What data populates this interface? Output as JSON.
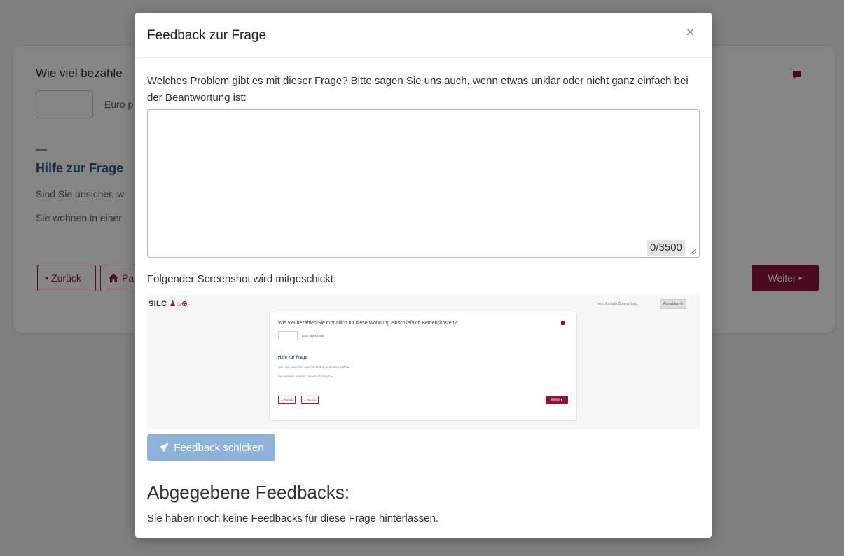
{
  "background": {
    "question_partial": "Wie viel bezahle",
    "unit_partial": "Euro p",
    "dash": "—",
    "help_title_partial": "Hilfe zur Frage",
    "help_link_1_partial": "Sind Sie unsicher, w",
    "help_link_2_partial": "Sie wohnen in einer",
    "back_label": "Zurück",
    "pause_label_partial": "Pa",
    "next_label": "Weiter",
    "icons": {
      "feedback": "speech-bubble-icon",
      "back": "caret-left-icon",
      "pause": "home-icon",
      "next": "caret-right-icon"
    }
  },
  "modal": {
    "title": "Feedback zur Frage",
    "close_label": "×",
    "prompt": "Welches Problem gibt es mit dieser Frage? Bitte sagen Sie uns auch, wenn etwas unklar oder nicht ganz einfach bei der Beantwortung ist:",
    "textarea_value": "",
    "counter": "0/3500",
    "screenshot_label": "Folgender Screenshot wird mitgeschickt:",
    "send_label": "Feedback schicken",
    "submitted_title": "Abgegebene Feedbacks:",
    "submitted_empty": "Sie haben noch keine Feedbacks für diese Frage hinterlassen."
  },
  "mini_screenshot": {
    "logo": "SILC",
    "logo_icons": "♟⌂⊕",
    "nav": "Infos   Kontakt   Datenschutz",
    "login": "Abmelden ⚙",
    "question": "Wie viel bezahlen Sie monatlich für diese Wohnung einschließlich Betriebskosten?",
    "unit": "Euro pro Monat",
    "dash": "—",
    "help_title": "Hilfe zur Frage",
    "help_link_1": "Sind Sie unsicher, was der Betrag enthalten soll? ▸",
    "help_link_2": "Sie wohnen in einer Dienstwohnung? ▸",
    "back": "◂ Zurück",
    "pause": "⌂ Pause",
    "next": "Weiter ▸"
  },
  "colors": {
    "accent": "#8c1538",
    "help_blue": "#2a5d8a",
    "send_button": "#8fb2d9",
    "overlay": "rgba(0,0,0,0.48)"
  }
}
